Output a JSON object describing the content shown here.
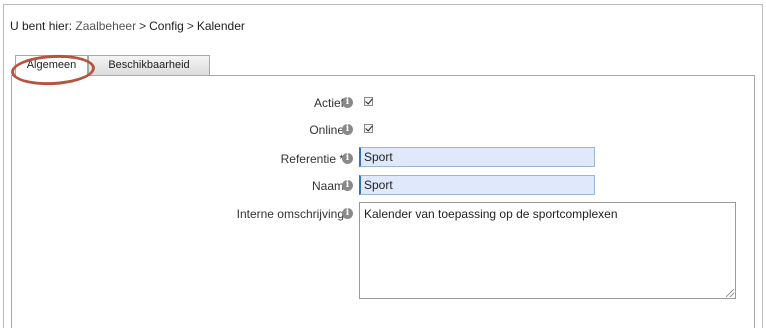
{
  "breadcrumb": {
    "prefix": "U bent hier:",
    "items": [
      "Zaalbeheer",
      "Config",
      "Kalender"
    ],
    "separator": ">"
  },
  "tabs": [
    {
      "label": "Algemeen",
      "active": true
    },
    {
      "label": "Beschikbaarheid",
      "active": false
    }
  ],
  "form": {
    "actief": {
      "label": "Actief",
      "checked": true
    },
    "online": {
      "label": "Online",
      "checked": true
    },
    "referentie": {
      "label": "Referentie *",
      "value": "Sport"
    },
    "naam": {
      "label": "Naam",
      "value": "Sport"
    },
    "interne_omschrijving": {
      "label": "Interne omschrijving",
      "value": "Kalender van toepassing op de sportcomplexen"
    },
    "info_glyph": "i"
  },
  "colors": {
    "highlight_ring": "#b4553f",
    "input_bg": "#dfe9fb",
    "input_focus_border": "#3a6fb0"
  }
}
